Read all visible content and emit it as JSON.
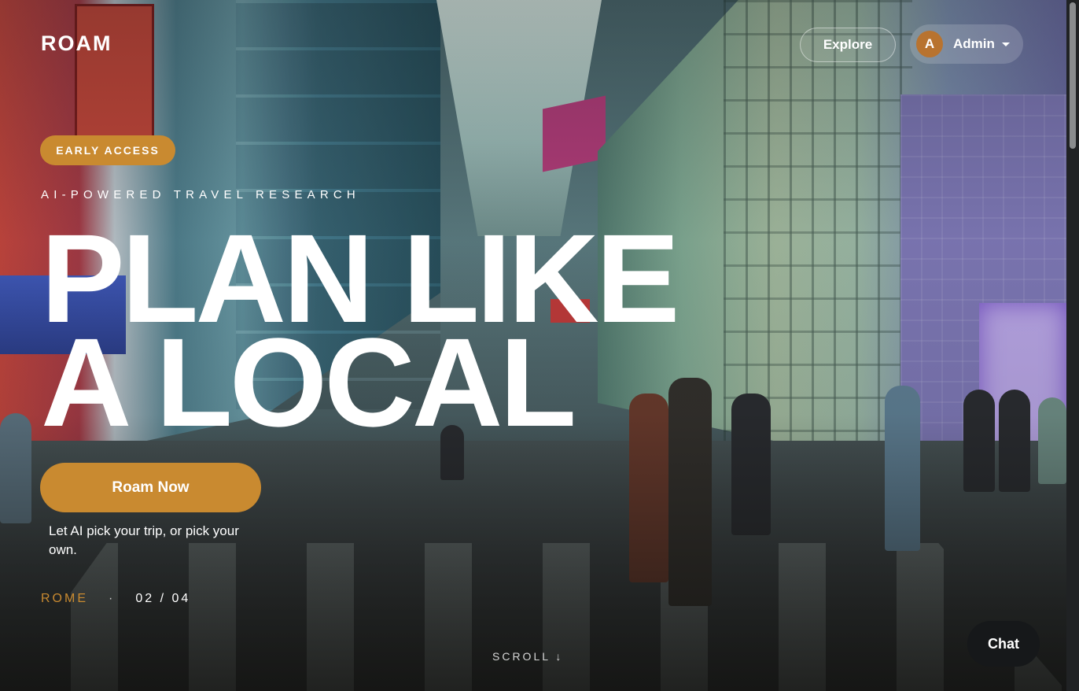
{
  "header": {
    "logo": "ROAM",
    "explore_label": "Explore",
    "user": {
      "initial": "A",
      "name": "Admin"
    }
  },
  "hero": {
    "badge": "EARLY ACCESS",
    "eyebrow": "AI-POWERED TRAVEL RESEARCH",
    "headline_line1": "PLAN LIKE",
    "headline_line2": "A LOCAL",
    "cta_label": "Roam Now",
    "subtext": "Let AI pick your trip, or pick your own."
  },
  "slide_indicator": {
    "city": "ROME",
    "separator": "·",
    "position": "02 / 04"
  },
  "scroll_hint": "SCROLL ↓",
  "chat_label": "Chat",
  "colors": {
    "accent": "#c98a30",
    "chat_bg": "#16181a"
  }
}
